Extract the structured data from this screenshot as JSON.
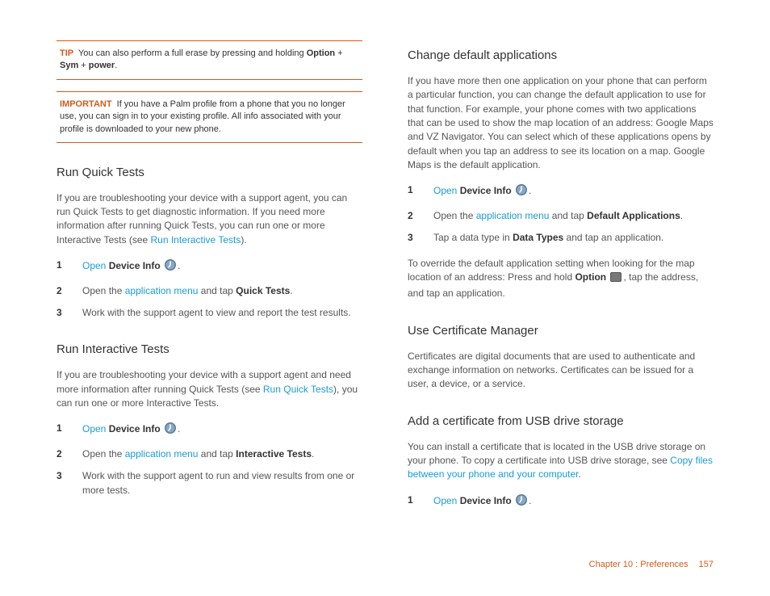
{
  "left": {
    "tip": {
      "label": "TIP",
      "text_a": "You can also perform a full erase by pressing and holding ",
      "option": "Option",
      "plus1": " + ",
      "sym": "Sym",
      "plus2": " + ",
      "power": "power",
      "text_b": "."
    },
    "important": {
      "label": "IMPORTANT",
      "text": "If you have a Palm profile from a phone that you no longer use, you can sign in to your existing profile. All info associated with your profile is downloaded to your new phone."
    },
    "quickTests": {
      "heading": "Run Quick Tests",
      "intro_a": "If you are troubleshooting your device with a support agent, you can run Quick Tests to get diagnostic information. If you need more information after running Quick Tests, you can run one or more Interactive Tests (see ",
      "intro_link": "Run Interactive Tests",
      "intro_b": ").",
      "step1_open": "Open",
      "step1_target": " Device Info ",
      "step1_end": ".",
      "step2_a": "Open the ",
      "step2_link": "application menu",
      "step2_b": " and tap ",
      "step2_bold": "Quick Tests",
      "step2_c": ".",
      "step3": "Work with the support agent to view and report the test results."
    },
    "interactiveTests": {
      "heading": "Run Interactive Tests",
      "intro_a": "If you are troubleshooting your device with a support agent and need more information after running Quick Tests (see ",
      "intro_link": "Run Quick Tests",
      "intro_b": "), you can run one or more Interactive Tests.",
      "step1_open": "Open",
      "step1_target": " Device Info ",
      "step1_end": ".",
      "step2_a": "Open the ",
      "step2_link": "application menu",
      "step2_b": " and tap ",
      "step2_bold": "Interactive Tests",
      "step2_c": ".",
      "step3": "Work with the support agent to run and view results from one or more tests."
    }
  },
  "right": {
    "defaultApps": {
      "heading": "Change default applications",
      "intro": "If you have more then one application on your phone that can perform a particular function, you can change the default application to use for that function. For example, your phone comes with two applications that can be used to show the map location of an address: Google Maps and VZ Navigator. You can select which of these applications opens by default when you tap an address to see its location on a map. Google Maps is the default application.",
      "step1_open": "Open",
      "step1_target": " Device Info ",
      "step1_end": ".",
      "step2_a": "Open the ",
      "step2_link": "application menu",
      "step2_b": " and tap ",
      "step2_bold": "Default Applications",
      "step2_c": ".",
      "step3_a": "Tap a data type in ",
      "step3_bold": "Data Types",
      "step3_b": " and tap an application.",
      "override_a": "To override the default application setting when looking for the map location of an address: Press and hold ",
      "override_bold": "Option",
      "override_b": ", tap the address, and tap an application."
    },
    "certMgr": {
      "heading": "Use Certificate Manager",
      "intro": "Certificates are digital documents that are used to authenticate and exchange information on networks. Certificates can be issued for a user, a device, or a service."
    },
    "addCert": {
      "heading": "Add a certificate from USB drive storage",
      "intro_a": "You can install a certificate that is located in the USB drive storage on your phone. To copy a certificate into USB drive storage, see ",
      "intro_link": "Copy files between your phone and your computer",
      "intro_b": ".",
      "step1_open": "Open",
      "step1_target": " Device Info ",
      "step1_end": "."
    }
  },
  "footer": {
    "chapter": "Chapter 10  :  Preferences",
    "page": "157"
  }
}
